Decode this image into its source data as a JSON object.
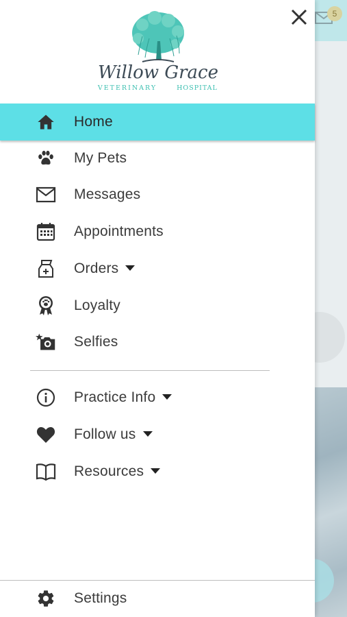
{
  "background": {
    "notification_count": "5"
  },
  "drawer": {
    "logo": {
      "line1": "Willow Grace",
      "line2a": "VETERINARY",
      "line2b": "HOSPITAL"
    },
    "menu": [
      {
        "label": "Home",
        "icon": "home-icon",
        "active": true
      },
      {
        "label": "My Pets",
        "icon": "paw-icon"
      },
      {
        "label": "Messages",
        "icon": "envelope-icon"
      },
      {
        "label": "Appointments",
        "icon": "calendar-icon"
      },
      {
        "label": "Orders",
        "icon": "food-bag-icon",
        "dropdown": true
      },
      {
        "label": "Loyalty",
        "icon": "award-ribbon-icon"
      },
      {
        "label": "Selfies",
        "icon": "camera-star-icon"
      }
    ],
    "secondary_menu": [
      {
        "label": "Practice Info",
        "icon": "info-icon",
        "dropdown": true
      },
      {
        "label": "Follow us",
        "icon": "heart-icon",
        "dropdown": true
      },
      {
        "label": "Resources",
        "icon": "book-icon",
        "dropdown": true
      }
    ],
    "settings": {
      "label": "Settings",
      "icon": "gear-icon"
    }
  },
  "colors": {
    "active_background": "#5ddfe6",
    "icon": "#3b3b3b",
    "logo_teal": "#3bbfb0",
    "logo_text": "#3c4a55"
  }
}
